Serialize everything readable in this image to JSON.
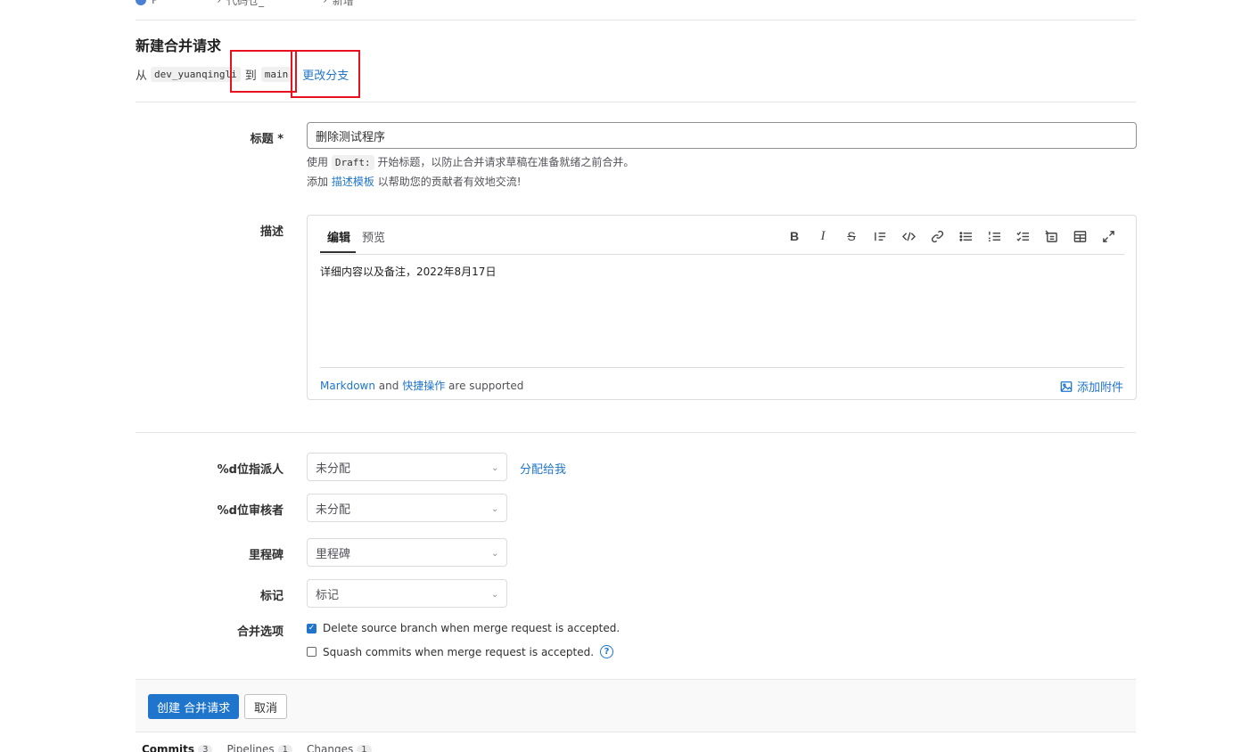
{
  "breadcrumb": {
    "items": [
      "P",
      "代码仓_",
      "新增"
    ]
  },
  "page": {
    "title": "新建合并请求",
    "from_label": "从",
    "source_branch": "dev_yuanqingli",
    "to_label": "到",
    "target_branch": "main",
    "change_branch_link": "更改分支"
  },
  "title_field": {
    "label": "标题 *",
    "value": "删除测试程序",
    "hint1_prefix": "使用",
    "hint1_code": "Draft:",
    "hint1_suffix": "开始标题，以防止合并请求草稿在准备就绪之前合并。",
    "hint2_prefix": "添加",
    "hint2_link": "描述模板",
    "hint2_suffix": "以帮助您的贡献者有效地交流!"
  },
  "description": {
    "label": "描述",
    "tab_edit": "编辑",
    "tab_preview": "预览",
    "content": "详细内容以及备注，2022年8月17日",
    "footer_markdown": "Markdown",
    "footer_and": "and",
    "footer_quick": "快捷操作",
    "footer_supported": "are supported",
    "attach_label": "添加附件",
    "toolbar_icons": [
      "bold-icon",
      "italic-icon",
      "strikethrough-icon",
      "quote-icon",
      "code-icon",
      "link-icon",
      "bullet-list-icon",
      "numbered-list-icon",
      "task-list-icon",
      "collapsible-icon",
      "table-icon",
      "fullscreen-icon"
    ]
  },
  "assignee": {
    "label": "%d位指派人",
    "value": "未分配",
    "assign_me": "分配给我"
  },
  "reviewer": {
    "label": "%d位审核者",
    "value": "未分配"
  },
  "milestone": {
    "label": "里程碑",
    "placeholder": "里程碑"
  },
  "labels": {
    "label": "标记",
    "placeholder": "标记"
  },
  "merge_options": {
    "label": "合并选项",
    "delete_source": "Delete source branch when merge request is accepted.",
    "delete_source_checked": true,
    "squash": "Squash commits when merge request is accepted.",
    "squash_checked": false
  },
  "actions": {
    "create": "创建 合并请求",
    "cancel": "取消"
  },
  "bottom_tabs": [
    {
      "label": "Commits",
      "count": "3"
    },
    {
      "label": "Pipelines",
      "count": "1"
    },
    {
      "label": "Changes",
      "count": "1"
    }
  ],
  "colors": {
    "accent": "#1f75cb",
    "annotation_box": "#e8121f"
  }
}
